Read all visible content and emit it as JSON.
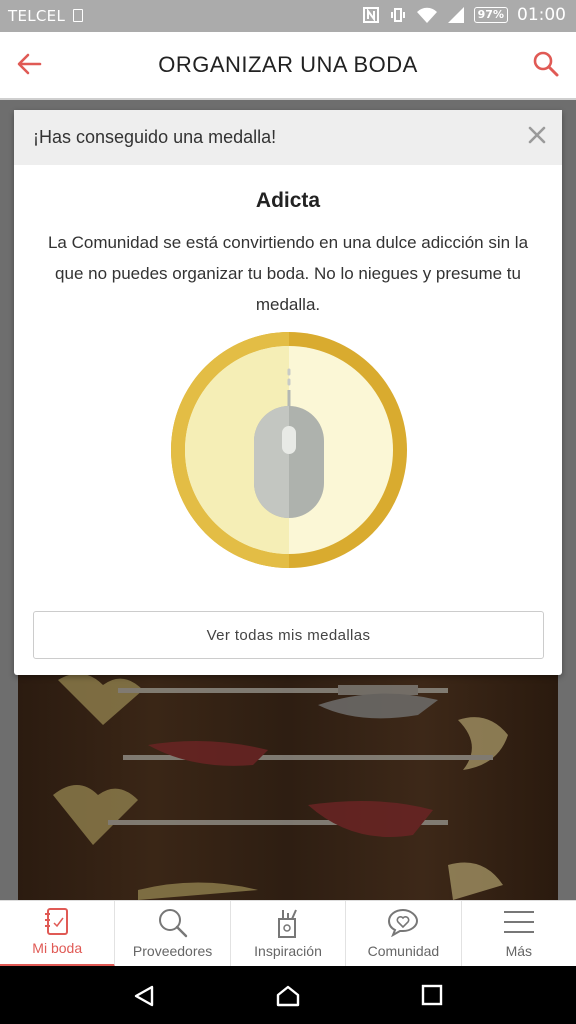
{
  "status_bar": {
    "carrier": "TELCEL",
    "battery": "97%",
    "time": "01:00"
  },
  "app_bar": {
    "title": "ORGANIZAR UNA BODA"
  },
  "modal": {
    "header": "¡Has conseguido una medalla!",
    "badge_name": "Adicta",
    "description": "La Comunidad se está convirtiendo en una dulce adicción sin la que no puedes organizar tu boda. No lo niegues y presume tu medalla.",
    "button_label": "Ver todas mis medallas",
    "medal_icon": "computer-mouse-icon"
  },
  "bottom_nav": {
    "items": [
      {
        "label": "Mi boda",
        "icon": "notebook-icon",
        "active": true
      },
      {
        "label": "Proveedores",
        "icon": "search-icon",
        "active": false
      },
      {
        "label": "Inspiración",
        "icon": "inspiration-icon",
        "active": false
      },
      {
        "label": "Comunidad",
        "icon": "chat-heart-icon",
        "active": false
      },
      {
        "label": "Más",
        "icon": "menu-icon",
        "active": false
      }
    ]
  },
  "colors": {
    "accent": "#e05a55",
    "medal_gold": "#d9ab2f",
    "medal_fill": "#fbf7d6"
  }
}
